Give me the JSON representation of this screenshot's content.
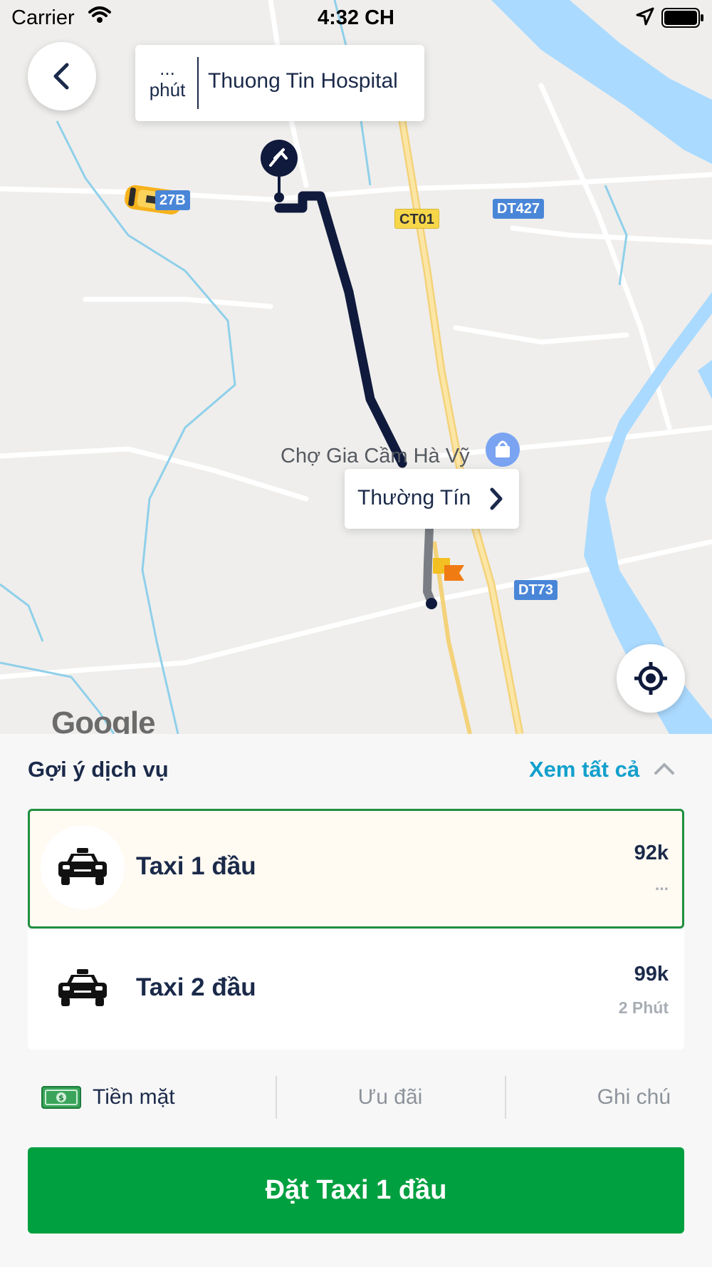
{
  "status_bar": {
    "carrier": "Carrier",
    "time": "4:32 CH"
  },
  "destination_card": {
    "eta_value": "...",
    "eta_unit": "phút",
    "name": "Thuong Tin Hospital"
  },
  "map": {
    "poi_label": "Chợ Gia Cầm Hà Vỹ",
    "pickup_callout": "Thường Tín",
    "road_badges": [
      "27B",
      "CT01",
      "DT427",
      "DT73"
    ],
    "attribution": "Google",
    "route_color": "#0f1a3c"
  },
  "sheet": {
    "title": "Gợi ý dịch vụ",
    "see_all": "Xem tất cả",
    "services": [
      {
        "name": "Taxi 1 đầu",
        "price": "92k",
        "eta": "...",
        "selected": true
      },
      {
        "name": "Taxi 2 đầu",
        "price": "99k",
        "eta": "2 Phút",
        "selected": false
      }
    ],
    "payment_label": "Tiền mặt",
    "promo_label": "Ưu đãi",
    "note_label": "Ghi chú",
    "book_button": "Đặt Taxi 1 đầu"
  },
  "colors": {
    "primary_green": "#00a040",
    "link_blue": "#12a0cc",
    "text_navy": "#1b2a4a",
    "river": "#aadaff"
  }
}
